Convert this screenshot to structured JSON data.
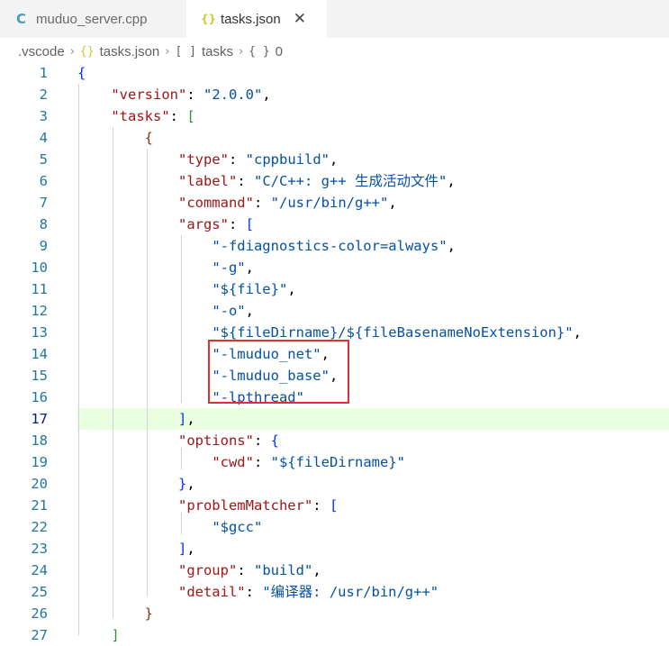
{
  "tabs": [
    {
      "icon": "C",
      "label": "muduo_server.cpp",
      "active": false
    },
    {
      "icon": "{}",
      "label": "tasks.json",
      "active": true,
      "close": "✕"
    }
  ],
  "breadcrumb": {
    "items": [
      {
        "icon": "",
        "label": ".vscode"
      },
      {
        "icon": "{}",
        "label": "tasks.json"
      },
      {
        "icon": "[ ]",
        "label": "tasks"
      },
      {
        "icon": "{ }",
        "label": "0"
      }
    ],
    "separator": "›"
  },
  "editor": {
    "active_line": 17,
    "highlight_color": "#e03030",
    "lines": [
      "{",
      "    \"version\": \"2.0.0\",",
      "    \"tasks\": [",
      "        {",
      "            \"type\": \"cppbuild\",",
      "            \"label\": \"C/C++: g++ 生成活动文件\",",
      "            \"command\": \"/usr/bin/g++\",",
      "            \"args\": [",
      "                \"-fdiagnostics-color=always\",",
      "                \"-g\",",
      "                \"${file}\",",
      "                \"-o\",",
      "                \"${fileDirname}/${fileBasenameNoExtension}\",",
      "                \"-lmuduo_net\",",
      "                \"-lmuduo_base\",",
      "                \"-lpthread\"",
      "            ],",
      "            \"options\": {",
      "                \"cwd\": \"${fileDirname}\"",
      "            },",
      "            \"problemMatcher\": [",
      "                \"$gcc\"",
      "            ],",
      "            \"group\": \"build\",",
      "            \"detail\": \"编译器: /usr/bin/g++\"",
      "        }",
      "    ]"
    ]
  }
}
